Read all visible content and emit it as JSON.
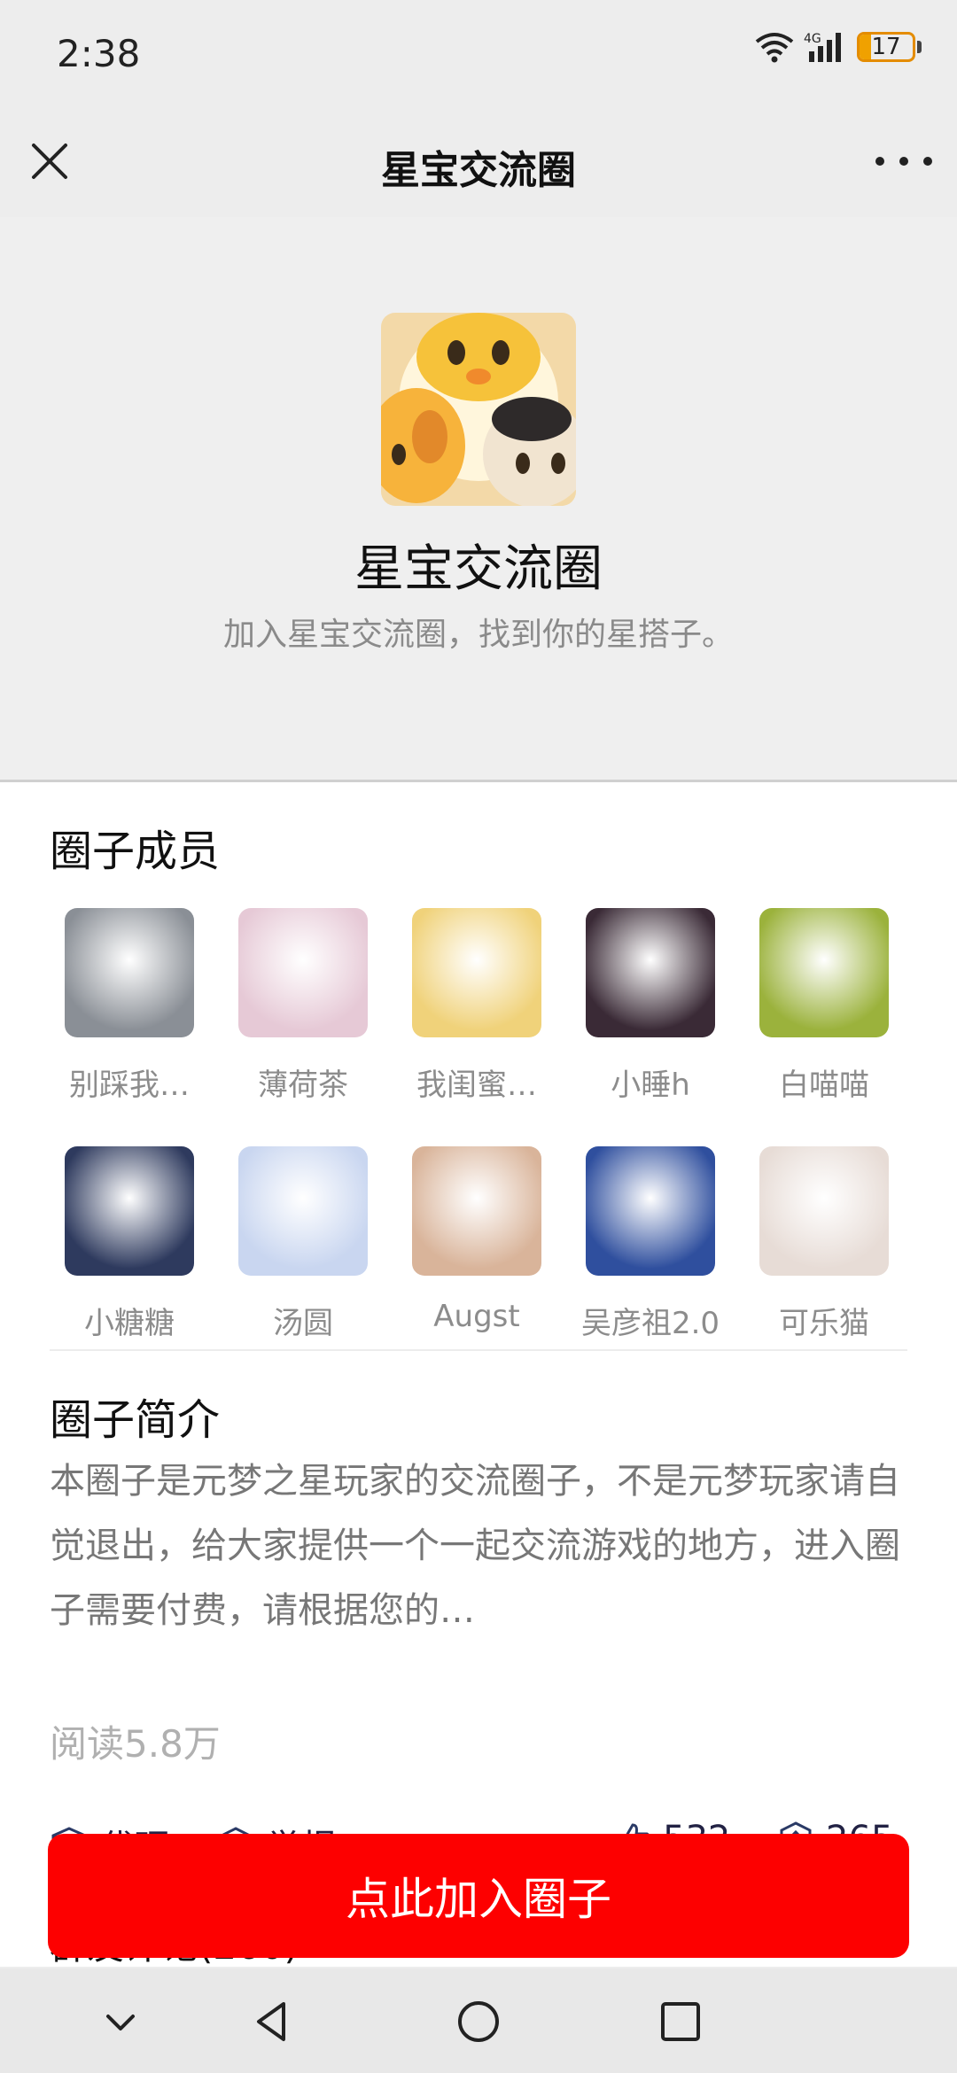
{
  "status_bar": {
    "time": "2:38",
    "network_label": "4G",
    "battery": "17",
    "battery_level_percent": 17,
    "battery_color": "#e48c00"
  },
  "nav": {
    "title": "星宝交流圈",
    "close_icon": "close-icon",
    "more_icon": "more-icon"
  },
  "header": {
    "name": "星宝交流圈",
    "subtitle": "加入星宝交流圈，找到你的星搭子。"
  },
  "members_section": {
    "title": "圈子成员",
    "members": [
      {
        "name": "别踩我…",
        "avatar_color": "#8a8f96"
      },
      {
        "name": "薄荷茶",
        "avatar_color": "#e6c9d6"
      },
      {
        "name": "我闺蜜…",
        "avatar_color": "#f0d27a"
      },
      {
        "name": "小睡h",
        "avatar_color": "#3a2a36"
      },
      {
        "name": "白喵喵",
        "avatar_color": "#9bb23c"
      },
      {
        "name": "小糖糖",
        "avatar_color": "#2e3a5e"
      },
      {
        "name": "汤圆",
        "avatar_color": "#c9d6f0"
      },
      {
        "name": "Augst",
        "avatar_color": "#d9b49a"
      },
      {
        "name": "吴彦祖2.0",
        "avatar_color": "#2f4f9e"
      },
      {
        "name": "可乐猫",
        "avatar_color": "#e7dcd6"
      }
    ]
  },
  "intro_section": {
    "title": "圈子简介",
    "text": "本圈子是元梦之星玩家的交流圈子，不是元梦玩家请自觉退出，给大家提供一个一起交流游戏的地方，进入圈子需要付费，请根据您的…"
  },
  "stats": {
    "reads": "阅读5.8万",
    "agent_label": "代理",
    "report_label": "举报",
    "likes": "532",
    "shares": "265"
  },
  "comments": {
    "title": "群友评论(260)"
  },
  "join_button": {
    "label": "点此加入圈子",
    "color": "#fd0000"
  },
  "system_nav": {
    "icons": [
      "chevron-down-icon",
      "back-icon",
      "home-icon",
      "recents-icon"
    ]
  }
}
